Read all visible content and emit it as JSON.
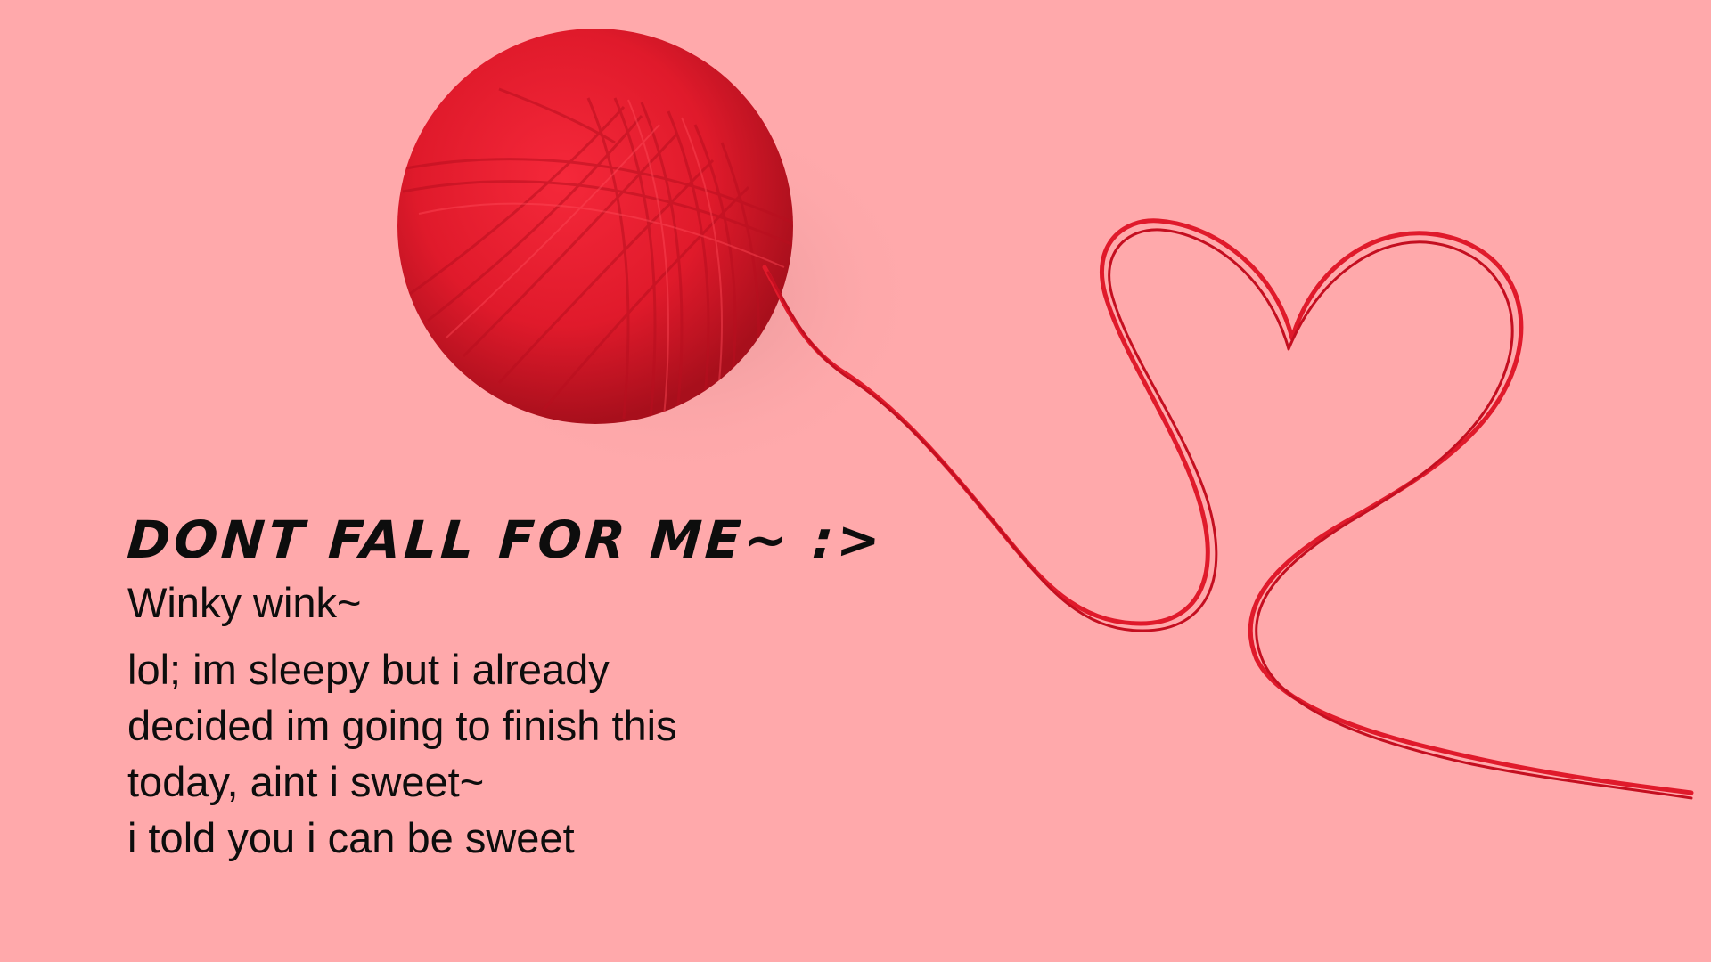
{
  "colors": {
    "background": "#ffa9ab",
    "yarn": "#e01a2b",
    "text": "#0d0d0d"
  },
  "artwork": {
    "yarn_ball": "red-yarn-ball",
    "heart_string": "red-yarn-heart"
  },
  "content": {
    "headline": "DONT FALL FOR ME~ :>",
    "subtitle": "Winky wink~",
    "lines": [
      "lol; im sleepy but i already",
      "decided im going to finish this",
      "today, aint i sweet~",
      "i told you i can be sweet"
    ]
  }
}
